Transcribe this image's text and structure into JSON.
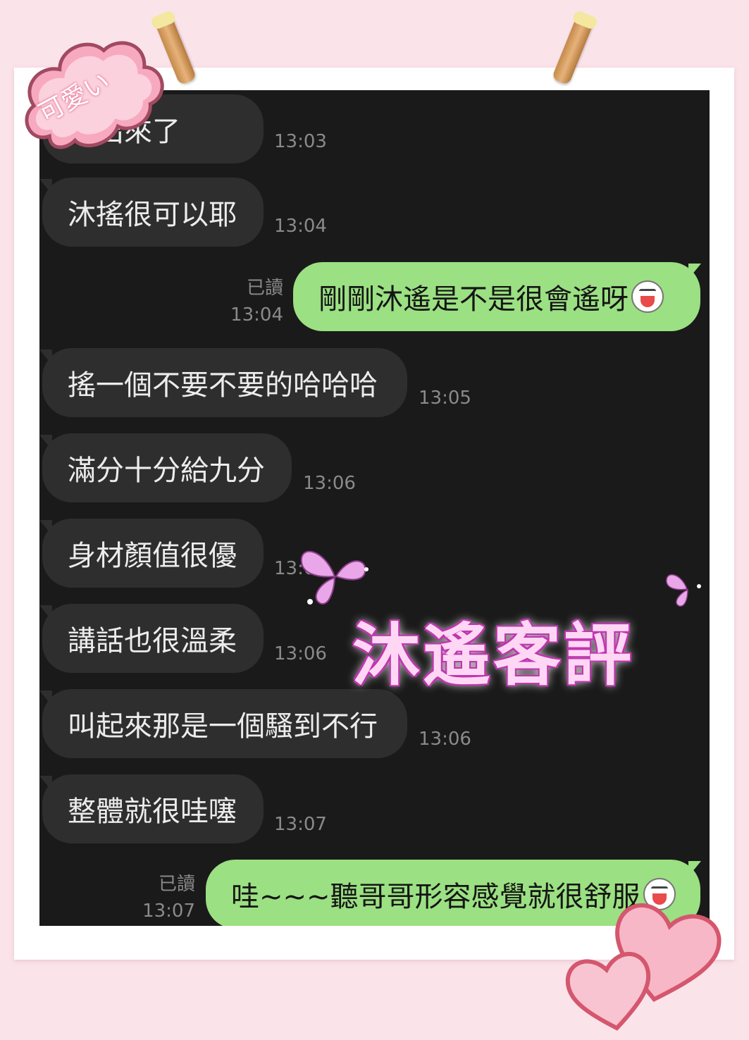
{
  "badge": {
    "text": "可愛い"
  },
  "overlay": {
    "title": "沐遙客評"
  },
  "messages": [
    {
      "text": "完出來了",
      "time": "13:03"
    },
    {
      "text": "沐搖很可以耶",
      "time": "13:04"
    },
    {
      "text": "剛剛沐遙是不是很會遙呀",
      "read": "已讀",
      "time": "13:04"
    },
    {
      "text": "搖一個不要不要的哈哈哈",
      "time": "13:05"
    },
    {
      "text": "滿分十分給九分",
      "time": "13:06"
    },
    {
      "text": "身材顏值很優",
      "time": "13:06"
    },
    {
      "text": "講話也很溫柔",
      "time": "13:06"
    },
    {
      "text": "叫起來那是一個騷到不行",
      "time": "13:06"
    },
    {
      "text": "整體就很哇噻",
      "time": "13:07"
    },
    {
      "text": "哇~~~聽哥哥形容感覺就很舒服",
      "read": "已讀",
      "time": "13:07"
    }
  ],
  "colors": {
    "background": "#fbe3ea",
    "chat_bg": "#1a1a1a",
    "incoming_bubble": "#2e2e2e",
    "outgoing_bubble": "#9be082",
    "title_glow": "#c037b0"
  },
  "icons": [
    "laughing-emoji-icon",
    "heart-icon",
    "butterfly-icon",
    "cloud-badge-icon",
    "clothespin-icon"
  ]
}
